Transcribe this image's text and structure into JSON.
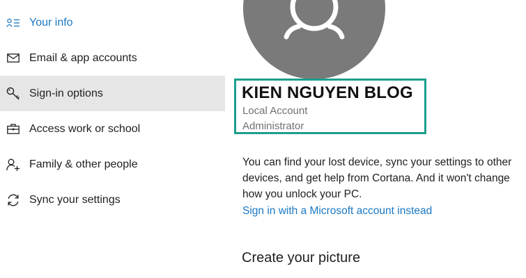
{
  "sidebar": {
    "items": [
      {
        "label": "Your info",
        "icon": "your-info-icon"
      },
      {
        "label": "Email & app accounts",
        "icon": "mail-icon"
      },
      {
        "label": "Sign-in options",
        "icon": "key-icon"
      },
      {
        "label": "Access work or school",
        "icon": "briefcase-icon"
      },
      {
        "label": "Family & other people",
        "icon": "person-add-icon"
      },
      {
        "label": "Sync your settings",
        "icon": "sync-icon"
      }
    ],
    "selected_index": 2,
    "active_index": 0
  },
  "account": {
    "name": "KIEN NGUYEN BLOG",
    "type": "Local Account",
    "role": "Administrator"
  },
  "main": {
    "description": "You can find your lost device, sync your settings to other devices, and get help from Cortana. And it won't change how you unlock your PC.",
    "ms_link": "Sign in with a Microsoft account instead",
    "section_heading": "Create your picture"
  },
  "colors": {
    "accent": "#1a78c2",
    "highlight_border": "#1b9e8c",
    "avatar": "#7a7a7a",
    "selected_bg": "#e6e6e6"
  }
}
